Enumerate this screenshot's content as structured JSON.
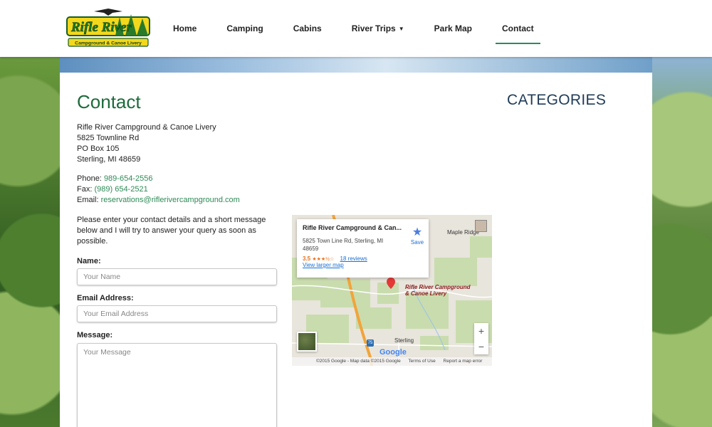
{
  "logo": {
    "line1": "Rifle River",
    "line2": "Campground & Canoe Livery"
  },
  "nav": [
    {
      "label": "Home"
    },
    {
      "label": "Camping"
    },
    {
      "label": "Cabins"
    },
    {
      "label": "River Trips"
    },
    {
      "label": "Park Map"
    },
    {
      "label": "Contact"
    }
  ],
  "page": {
    "title": "Contact",
    "sidebar_title": "CATEGORIES",
    "address": [
      "Rifle River Campground & Canoe Livery",
      "5825 Townline Rd",
      "PO Box 105",
      "Sterling, MI 48659"
    ],
    "phone_label": "Phone:",
    "phone": "989-654-2556",
    "fax_label": "Fax:",
    "fax": "(989) 654-2521",
    "email_label": "Email:",
    "email": "reservations@riflerivercampground.com",
    "intro": "Please enter your contact details and a short message below and I will try to answer your query as soon as possible."
  },
  "form": {
    "name_label": "Name:",
    "name_placeholder": "Your Name",
    "email_label": "Email Address:",
    "email_placeholder": "Your Email Address",
    "message_label": "Message:",
    "message_placeholder": "Your Message"
  },
  "map": {
    "card_title": "Rifle River Campground & Can...",
    "card_address": "5825 Town Line Rd, Sterling, MI 48659",
    "rating": "3.5",
    "stars": "★★★½☆",
    "reviews": "18 reviews",
    "larger_link": "View larger map",
    "save_label": "Save",
    "place_label_1": "Rifle River Campground",
    "place_label_2": "& Canoe Livery",
    "town": "Sterling",
    "town2": "Maple Ridge",
    "highway": "75",
    "google": "Google",
    "footer": [
      "©2015 Google - Map data ©2015 Google",
      "Terms of Use",
      "Report a map error"
    ],
    "zoom_in": "+",
    "zoom_out": "−"
  }
}
